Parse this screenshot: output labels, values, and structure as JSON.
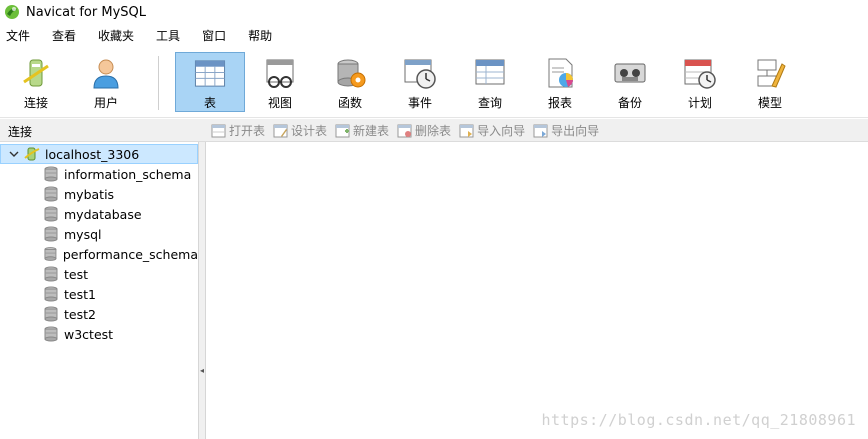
{
  "window": {
    "title": "Navicat for MySQL"
  },
  "menu": [
    "文件",
    "查看",
    "收藏夹",
    "工具",
    "窗口",
    "帮助"
  ],
  "toolbar": [
    {
      "label": "连接",
      "icon": "connection-icon"
    },
    {
      "label": "用户",
      "icon": "user-icon"
    },
    {
      "label": "表",
      "icon": "table-icon",
      "active": true
    },
    {
      "label": "视图",
      "icon": "view-icon"
    },
    {
      "label": "函数",
      "icon": "function-icon"
    },
    {
      "label": "事件",
      "icon": "event-icon"
    },
    {
      "label": "查询",
      "icon": "query-icon"
    },
    {
      "label": "报表",
      "icon": "report-icon"
    },
    {
      "label": "备份",
      "icon": "backup-icon"
    },
    {
      "label": "计划",
      "icon": "schedule-icon"
    },
    {
      "label": "模型",
      "icon": "model-icon"
    }
  ],
  "subbar": {
    "connection_label": "连接",
    "actions": [
      "打开表",
      "设计表",
      "新建表",
      "删除表",
      "导入向导",
      "导出向导"
    ]
  },
  "tree": {
    "connection": "localhost_3306",
    "databases": [
      "information_schema",
      "mybatis",
      "mydatabase",
      "mysql",
      "performance_schema",
      "test",
      "test1",
      "test2",
      "w3ctest"
    ]
  },
  "watermark": "https://blog.csdn.net/qq_21808961",
  "colors": {
    "active_button": "#a9d4f5",
    "selected_row": "#cce8ff"
  }
}
